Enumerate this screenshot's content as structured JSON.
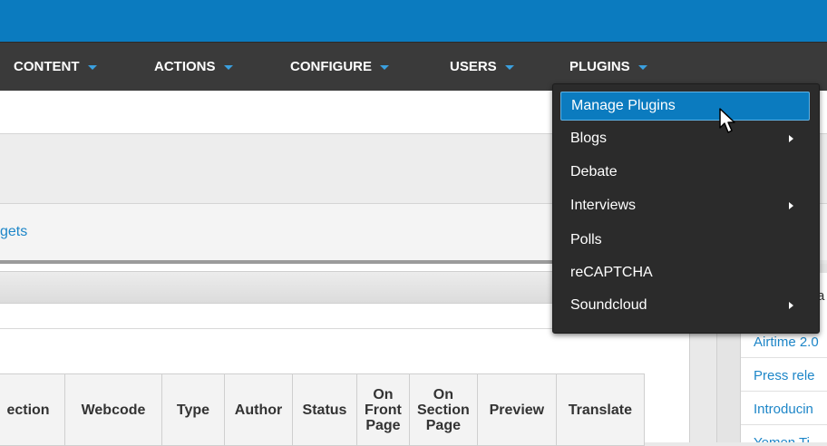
{
  "nav": {
    "items": [
      {
        "label": "CONTENT"
      },
      {
        "label": "ACTIONS"
      },
      {
        "label": "CONFIGURE"
      },
      {
        "label": "USERS"
      },
      {
        "label": "PLUGINS"
      }
    ]
  },
  "link_row": {
    "text": "gets"
  },
  "table": {
    "headers": [
      "ection",
      "Webcode",
      "Type",
      "Author",
      "Status",
      "On Front Page",
      "On Section Page",
      "Preview",
      "Translate"
    ]
  },
  "right": {
    "heading_partial": "a",
    "links": [
      "Airtime 2.0",
      "Press rele",
      "Introducin",
      "Yemen Ti"
    ]
  },
  "dropdown": {
    "items": [
      {
        "label": "Manage Plugins",
        "active": true,
        "submenu": false
      },
      {
        "label": "Blogs",
        "submenu": true
      },
      {
        "label": "Debate",
        "submenu": false
      },
      {
        "label": "Interviews",
        "submenu": true
      },
      {
        "label": "Polls",
        "submenu": false
      },
      {
        "label": "reCAPTCHA",
        "submenu": false
      },
      {
        "label": "Soundcloud",
        "submenu": true
      }
    ]
  },
  "colors": {
    "topbar": "#0b7bbf",
    "nav": "#3a3a3a",
    "accent": "#3aa0df",
    "link": "#1d86c8"
  }
}
